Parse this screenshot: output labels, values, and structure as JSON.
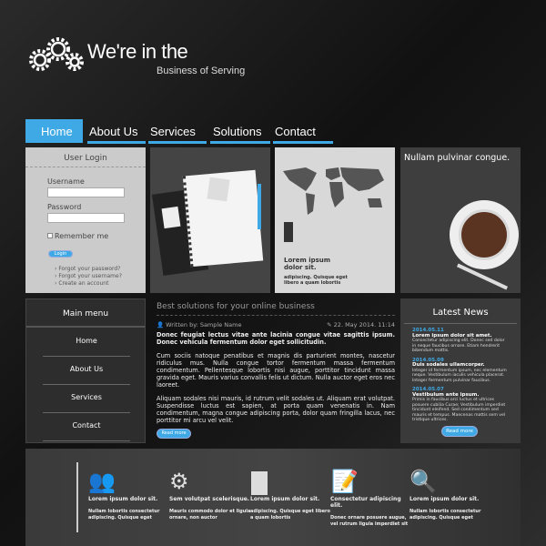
{
  "logo": {
    "line1": "We're in the",
    "line2": "Business of Serving",
    "icon": "gears-icon"
  },
  "nav": {
    "items": [
      "Home",
      "About Us",
      "Services",
      "Solutions",
      "Contact"
    ],
    "active": "Home",
    "accent": "#3fa9e6"
  },
  "login": {
    "title": "User Login",
    "username_label": "Username",
    "password_label": "Password",
    "username_value": "",
    "password_value": "",
    "remember": "Remember me",
    "button": "Login",
    "links": [
      "Forgot your password?",
      "Forgot your username?",
      "Create an account"
    ]
  },
  "map_panel": {
    "title": "Lorem ipsum dolor sit.",
    "text": "adipiscing. Quisque eget libero a quam lobortis"
  },
  "coffee_panel": {
    "title": "Nullam pulvinar congue."
  },
  "main_menu": {
    "title": "Main menu",
    "items": [
      "Home",
      "About Us",
      "Services",
      "Contact"
    ]
  },
  "article": {
    "title": "Best solutions for your online business",
    "author": "Written by: Sample Name",
    "date": "22. May 2014.  11:14",
    "lead": "Donec feugiat lectus vitae ante lacinia congue vitae sagittis ipsum. Donec vehicula fermentum dolor eget sollicitudin.",
    "p1": "Cum sociis natoque penatibus et magnis dis parturient montes, nascetur ridiculus mus. Nulla congue tortor fermentum massa fermentum condimentum. Pellentesque lobortis nisi augue, porttitor tincidunt massa gravida eget. Mauris varius convallis felis ut dictum. Nulla auctor eget eros nec laoreet.",
    "p2": "Aliquam sodales nisi mauris, id rutrum velit sodales ut. Aliquam erat volutpat. Suspendisse luctus est sapien, at porta quam venenatis in. Nam condimentum, magna congue adipiscing porta, dolor quam fringilla lacus, nec porttitor mi arcu vel velit.",
    "button": "Read more"
  },
  "news": {
    "title": "Latest News",
    "items": [
      {
        "date": "2014.05.11",
        "head": "Lorem ipsum dolor sit amet.",
        "text": "Consectetur adipiscing elit. Donec sed dolor in neque faucibus ornare. Etiam hendrerit bibendum mattis."
      },
      {
        "date": "2014.05.09",
        "head": "Duis sodales ullamcorper.",
        "text": "Integer id fermentum ipsum, nec elementum neque. Vestibulum iaculis vehicula placerat. Integer fermentum pulvinar faucibus."
      },
      {
        "date": "2014.05.07",
        "head": "Vestibulum ante ipsum.",
        "text": "Primis in faucibus orci luctus et ultrices posuere cubilia Curae; Vestibulum imperdiet tincidunt eleifend. Sed condimentum sed mauris et tempus. Maecenas mattis sem vel tristique ultrices."
      }
    ],
    "button": "Read more"
  },
  "footer": [
    {
      "icon": "team-icon",
      "title": "Lorem ipsum dolor sit.",
      "text": "Nullam lobortis consectetur adipiscing. Quisque eget"
    },
    {
      "icon": "gear-user-icon",
      "title": "Sem volutpat scelerisque.",
      "text": "Mauris commodo dolor et ligula ornare, non auctor"
    },
    {
      "icon": "speaker-podium-icon",
      "title": "Lorem ipsum dolor sit.",
      "text": "adipiscing. Quisque eget libero a quam lobortis"
    },
    {
      "icon": "resume-icon",
      "title": "Consectetur adipiscing elit.",
      "text": "Donec ornare posuere augue, vel rutrum ligula imperdiet sit"
    },
    {
      "icon": "search-user-icon",
      "title": "Lorem ipsum dolor sit.",
      "text": "Nullam lobortis consectetur adipiscing. Quisque eget"
    }
  ]
}
